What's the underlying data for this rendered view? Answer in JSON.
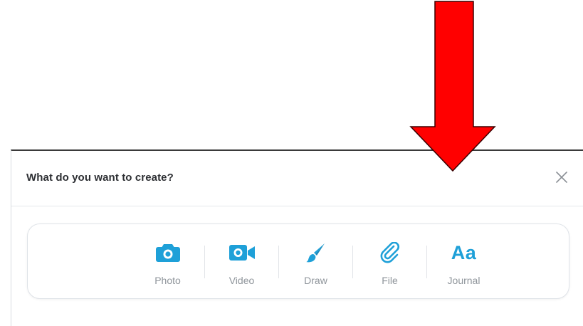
{
  "dialog": {
    "title": "What do you want to create?"
  },
  "options": [
    {
      "label": "Photo",
      "icon": "camera-icon"
    },
    {
      "label": "Video",
      "icon": "video-camera-icon"
    },
    {
      "label": "Draw",
      "icon": "paintbrush-icon"
    },
    {
      "label": "File",
      "icon": "paperclip-icon"
    },
    {
      "label": "Journal",
      "icon": "text-aa-icon",
      "glyph": "Aa"
    }
  ],
  "colors": {
    "accent": "#1ea0d8",
    "label": "#8f959b",
    "arrow": "#ff0000"
  }
}
